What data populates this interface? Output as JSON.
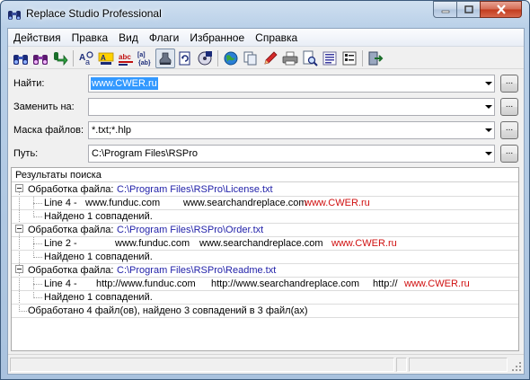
{
  "window": {
    "title": "Replace Studio Professional"
  },
  "menu": [
    "Действия",
    "Правка",
    "Вид",
    "Флаги",
    "Избранное",
    "Справка"
  ],
  "toolbar_icons": [
    "find-icon",
    "find-all-icon",
    "replace-go-icon",
    "match-case-icon",
    "whole-word-icon",
    "abc-icon",
    "regex-icon",
    "stamp-icon",
    "refresh-icon",
    "cd-icon",
    "globe-icon",
    "copy-icon",
    "edit-pen-icon",
    "print-icon",
    "find-file-icon",
    "list-icon",
    "checklist-icon",
    "exit-icon"
  ],
  "form": {
    "find": {
      "label": "Найти:",
      "value": "www.CWER.ru"
    },
    "replace": {
      "label": "Заменить на:",
      "value": ""
    },
    "mask": {
      "label": "Маска файлов:",
      "value": "*.txt;*.hlp"
    },
    "path": {
      "label": "Путь:",
      "value": "C:\\Program Files\\RSPro"
    },
    "browse_label": "..."
  },
  "results": {
    "title": "Результаты поиска",
    "processing_label": "Обработка файла:",
    "files": [
      {
        "path": "C:\\Program Files\\RSPro\\License.txt",
        "line": {
          "prefix": "Line   4 -",
          "text1": "www.funduc.com",
          "text2": "www.searchandreplace.com",
          "text3": "",
          "hit": "www.CWER.ru"
        },
        "found": "Найдено 1 совпадений."
      },
      {
        "path": "C:\\Program Files\\RSPro\\Order.txt",
        "line": {
          "prefix": "Line   2 -",
          "text1": "www.funduc.com",
          "text2": "www.searchandreplace.com",
          "text3": "",
          "hit": "www.CWER.ru"
        },
        "found": "Найдено 1 совпадений."
      },
      {
        "path": "C:\\Program Files\\RSPro\\Readme.txt",
        "line": {
          "prefix": "Line   4 -",
          "text1": "http://www.funduc.com",
          "text2": "http://www.searchandreplace.com",
          "text3": "http://",
          "hit": "www.CWER.ru"
        },
        "found": "Найдено 1 совпадений."
      }
    ],
    "summary": "Обработано 4 файл(ов), найдено 3 совпадений в 3 файл(ах)"
  },
  "colors": {
    "path": "#1f1fa8",
    "hit": "#d01010",
    "selection": "#3399ff",
    "close": "#c23b1d"
  }
}
